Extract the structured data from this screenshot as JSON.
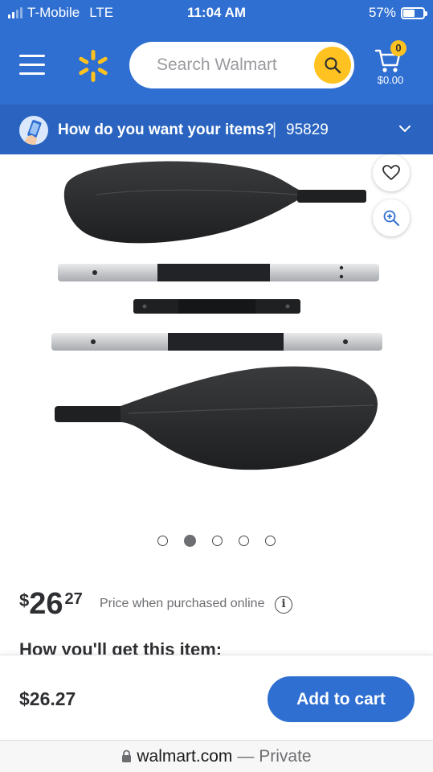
{
  "status_bar": {
    "carrier": "T-Mobile",
    "network": "LTE",
    "time": "11:04 AM",
    "battery_percent": "57%",
    "battery_level": 0.57,
    "signal_bars": 2
  },
  "header": {
    "search_placeholder": "Search Walmart",
    "cart_count": "0",
    "cart_total": "$0.00",
    "brand_color": "#2f6fd1",
    "accent_color": "#ffc220"
  },
  "delivery": {
    "question": "How do you want your items?",
    "separator": "|",
    "zip": "95829"
  },
  "product": {
    "image_icon": "kayak-paddle-image",
    "carousel": {
      "total": 5,
      "active_index": 2
    },
    "price": {
      "currency": "$",
      "dollars": "26",
      "cents": "27"
    },
    "price_note": "Price when purchased online",
    "info_glyph": "i",
    "fulfillment_heading": "How you'll get this item:"
  },
  "sticky": {
    "price": "$26.27",
    "add_to_cart_label": "Add to cart"
  },
  "browser": {
    "domain": "walmart.com",
    "mode": "— Private"
  }
}
